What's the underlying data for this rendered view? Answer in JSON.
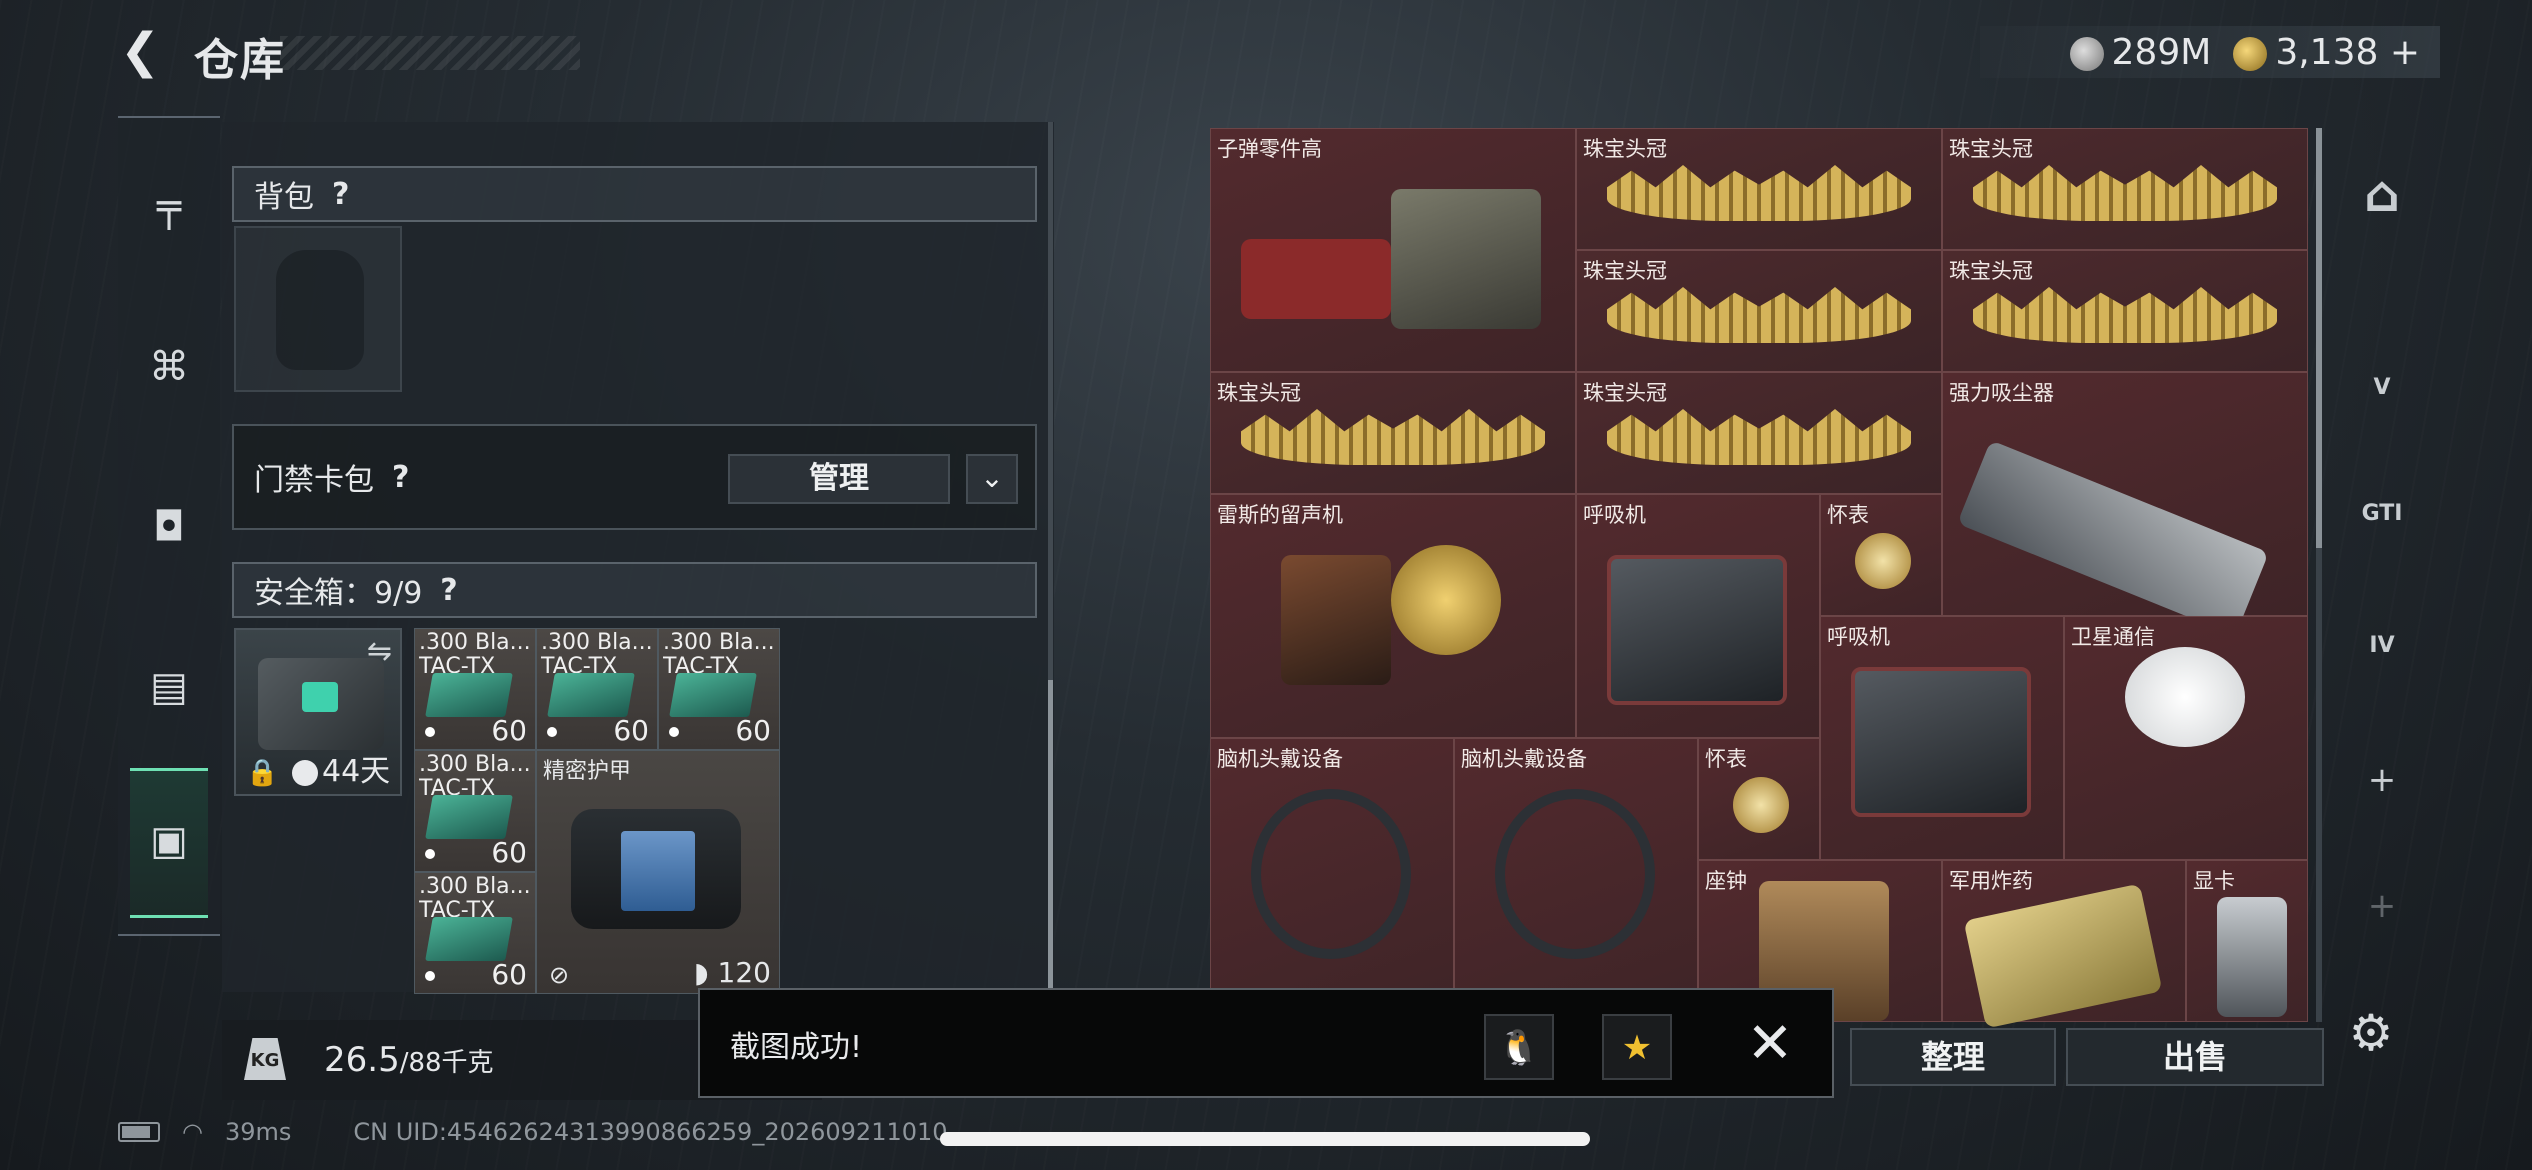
{
  "header": {
    "title": "仓库",
    "currency": [
      {
        "icon": "silver-coin-icon",
        "value": "289M"
      },
      {
        "icon": "gold-coin-icon",
        "value": "3,138"
      }
    ],
    "add_label": "+"
  },
  "left_nav": [
    {
      "name": "nav-weapon",
      "icon": "pistol-icon",
      "glyph": "╤"
    },
    {
      "name": "nav-vest",
      "icon": "vest-icon",
      "glyph": "⌘"
    },
    {
      "name": "nav-helmet",
      "icon": "helmet-icon",
      "glyph": "◘"
    },
    {
      "name": "nav-backpack",
      "icon": "backpack-icon",
      "glyph": "▤"
    },
    {
      "name": "nav-case",
      "icon": "toolbox-icon",
      "glyph": "▣"
    }
  ],
  "backpack": {
    "label": "背包",
    "help": "?"
  },
  "keycard": {
    "label": "门禁卡包",
    "help": "?",
    "manage_label": "管理",
    "dropdown_glyph": "⌄"
  },
  "safebox": {
    "label": "安全箱：9/9",
    "help": "?",
    "days": "44天"
  },
  "safe_items": [
    {
      "name": ".300 Bla...",
      "sub": "TAC-TX",
      "count": "60"
    },
    {
      "name": ".300 Bla...",
      "sub": "TAC-TX",
      "count": "60"
    },
    {
      "name": ".300 Bla...",
      "sub": "TAC-TX",
      "count": "60"
    },
    {
      "name": ".300 Bla...",
      "sub": "TAC-TX",
      "count": "60"
    },
    {
      "name": ".300 Bla...",
      "sub": "TAC-TX",
      "count": "60"
    }
  ],
  "armor": {
    "name": "精密护甲",
    "durability": "120"
  },
  "weight": {
    "current": "26.5",
    "max": "/88千克",
    "icon_text": "KG"
  },
  "stash_items": [
    {
      "label": "子弹零件高"
    },
    {
      "label": "珠宝头冠"
    },
    {
      "label": "珠宝头冠"
    },
    {
      "label": "珠宝头冠"
    },
    {
      "label": "珠宝头冠"
    },
    {
      "label": "珠宝头冠"
    },
    {
      "label": "珠宝头冠"
    },
    {
      "label": "强力吸尘器"
    },
    {
      "label": "雷斯的留声机"
    },
    {
      "label": "呼吸机"
    },
    {
      "label": "怀表"
    },
    {
      "label": "呼吸机"
    },
    {
      "label": "卫星通信"
    },
    {
      "label": "脑机头戴设备"
    },
    {
      "label": "脑机头戴设备"
    },
    {
      "label": "怀表"
    },
    {
      "label": "座钟"
    },
    {
      "label": "军用炸药"
    },
    {
      "label": "显卡"
    }
  ],
  "right_tabs": [
    {
      "label": "",
      "icon": "stash-main-icon"
    },
    {
      "label": "V",
      "icon": "stash-v-icon"
    },
    {
      "label": "GTI",
      "icon": "stash-gti-icon"
    },
    {
      "label": "IV",
      "icon": "stash-iv-icon"
    },
    {
      "label": "+",
      "icon": "add-tab-icon"
    },
    {
      "label": "+",
      "icon": "add-tab-icon-2"
    }
  ],
  "actions": {
    "sort_label": "整理",
    "sell_label": "出售"
  },
  "toast": {
    "message": "截图成功!",
    "share1_icon": "qq-penguin-icon",
    "share2_icon": "qzone-star-icon",
    "close": "✕"
  },
  "status": {
    "ping": "39ms",
    "uid": "CN UID:4546262431399086​6259_202609211010"
  }
}
